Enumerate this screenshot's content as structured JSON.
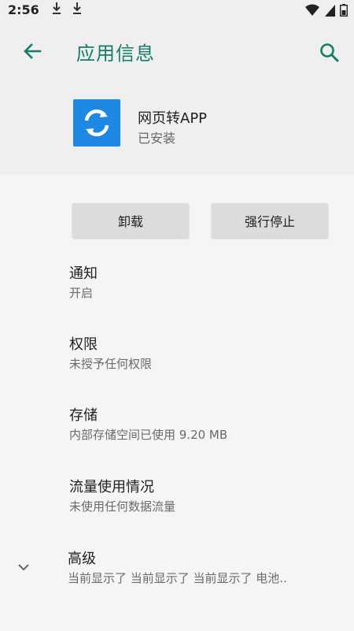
{
  "status_bar": {
    "time": "2:56",
    "icons": [
      "download-icon",
      "download-icon",
      "wifi-icon",
      "signal-icon",
      "battery-icon"
    ]
  },
  "app_bar": {
    "title": "应用信息",
    "icons": [
      "back-arrow-icon",
      "search-icon"
    ],
    "accent_color": "#157c6a"
  },
  "app": {
    "name": "网页转APP",
    "status": "已安装",
    "icon": "sync-icon",
    "icon_color": "#1e88e5"
  },
  "buttons": {
    "uninstall": "卸载",
    "force_stop": "强行停止"
  },
  "settings": [
    {
      "title": "通知",
      "summary": "开启"
    },
    {
      "title": "权限",
      "summary": "未授予任何权限"
    },
    {
      "title": "存储",
      "summary": "内部存储空间已使用 9.20 MB"
    },
    {
      "title": "流量使用情况",
      "summary": "未使用任何数据流量"
    }
  ],
  "advanced": {
    "title": "高级",
    "summary": "当前显示了 当前显示了 当前显示了 电池..",
    "icon": "chevron-down-icon"
  }
}
